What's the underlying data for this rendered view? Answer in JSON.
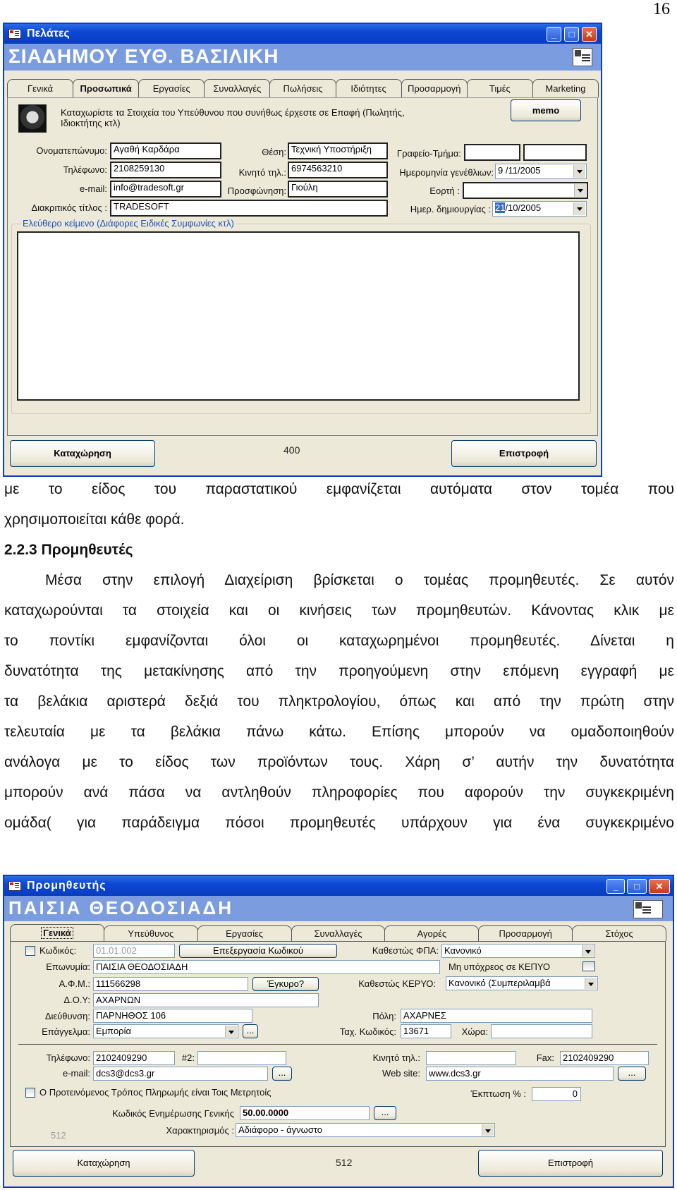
{
  "page_number": "16",
  "customer_window": {
    "title": "Πελάτες",
    "header_name": "ΣΙΑΔΗΜΟΥ ΕΥΘ. ΒΑΣΙΛΙΚΗ",
    "tabs": [
      {
        "label": "Γενικά",
        "active": false
      },
      {
        "label": "Προσωπικά",
        "active": true
      },
      {
        "label": "Εργασίες",
        "active": false
      },
      {
        "label": "Συναλλαγές",
        "active": false
      },
      {
        "label": "Πωλήσεις",
        "active": false
      },
      {
        "label": "Ιδιότητες",
        "active": false
      },
      {
        "label": "Προσαρμογή",
        "active": false
      },
      {
        "label": "Τιμές",
        "active": false
      },
      {
        "label": "Marketing",
        "active": false
      }
    ],
    "instruction": "Καταχωρίστε τα Στοιχεία του Υπεύθυνου που συνήθως έρχεστε σε Επαφή (Πωλητής, Ιδιοκτήτης κτλ)",
    "memo_label": "memo",
    "fields": {
      "fullname_label": "Ονοματεπώνυμο:",
      "fullname_value": "Αγαθή Καρδάρα",
      "phone_label": "Τηλέφωνο:",
      "phone_value": "2108259130",
      "email_label": "e-mail:",
      "email_value": "info@tradesoft.gr",
      "title_label": "Διακριτικός τίτλος :",
      "title_value": "TRADESOFT",
      "position_label": "Θέση:",
      "position_value": "Τεχνική Υποστήριξη",
      "mobile_label": "Κινητό τηλ.:",
      "mobile_value": "6974563210",
      "salutation_label": "Προσφώνηση:",
      "salutation_value": "Γιούλη",
      "office_label": "Γραφείο-Τμήμα:",
      "office_value_1": "",
      "office_value_2": "",
      "birthday_label": "Ημερομηνία γενέθλιων:",
      "birthday_value": "9 /11/2005",
      "nameday_label": "Εορτή :",
      "nameday_value": "",
      "created_label": "Ημερ. δημιουργίας :",
      "created_day": "21",
      "created_rest": "/10/2005"
    },
    "freetext_label": "Ελεύθερο κείμενο (Διάφορες Ειδικές Συμφωνίες κτλ)",
    "freetext_value": "",
    "save_label": "Καταχώρηση",
    "record_number": "400",
    "back_label": "Επιστροφή"
  },
  "document": {
    "para1": "με το είδος του παραστατικού εμφανίζεται αυτόματα στον τομέα που",
    "para1_end": "χρησιμοποιείται κάθε φορά.",
    "heading": "2.2.3 Προμηθευτές",
    "para2_lines": [
      "Μέσα στην επιλογή Διαχείριση βρίσκεται ο τομέας προμηθευτές. Σε αυτόν",
      "καταχωρούνται τα στοιχεία και οι κινήσεις των προμηθευτών. Κάνοντας κλικ με",
      "το ποντίκι εμφανίζονται όλοι οι καταχωρημένοι προμηθευτές. Δίνεται η",
      "δυνατότητα της μετακίνησης από την προηγούμενη στην επόμενη εγγραφή με",
      "τα βελάκια αριστερά δεξιά του πληκτρολογίου, όπως και από την πρώτη στην",
      "τελευταία με τα βελάκια πάνω κάτω. Επίσης μπορούν να ομαδοποιηθούν",
      "ανάλογα με το είδος των προϊόντων τους. Χάρη σ’ αυτήν την δυνατότητα",
      "μπορούν ανά πάσα να αντληθούν πληροφορίες που αφορούν την συγκεκριμένη",
      "ομάδα( για παράδειγμα πόσοι προμηθευτές υπάρχουν για ένα συγκεκριμένο"
    ]
  },
  "supplier_window": {
    "title": "Προμηθευτής",
    "header_name": "ΠΑΙΣΙΑ ΘΕΟΔΟΣΙΑΔΗ",
    "tabs": [
      {
        "label": "Γενικά",
        "active": true
      },
      {
        "label": "Υπεύθυνος",
        "active": false
      },
      {
        "label": "Εργασίες",
        "active": false
      },
      {
        "label": "Συναλλαγές",
        "active": false
      },
      {
        "label": "Αγορές",
        "active": false
      },
      {
        "label": "Προσαρμογή",
        "active": false
      },
      {
        "label": "Στόχος",
        "active": false
      }
    ],
    "code_label": "Κωδικός:",
    "code_value": "01.01.002",
    "edit_code_label": "Επεξεργασία Κωδικού",
    "vat_status_label": "Καθεστώς ΦΠΑ:",
    "vat_status_value": "Κανονικό",
    "name_label": "Επωνυμία:",
    "name_value": "ΠΑΙΣΙΑ ΘΕΟΔΟΣΙΑΔΗ",
    "kepyo_exempt_label": "Μη υπόχρεος σε ΚΕΠΥΟ",
    "afm_label": "Α.Φ.Μ.:",
    "afm_value": "111566298",
    "valid_label": "Έγκυρο?",
    "kepyo_status_label": "Καθεστώς ΚΕΡΥΟ:",
    "kepyo_status_value": "Κανονικό (Συμπεριλαμβά",
    "doy_label": "Δ.Ο.Υ:",
    "doy_value": "ΑΧΑΡΝΩΝ",
    "address_label": "Διεύθυνση:",
    "address_value": "ΠΑΡΝΗΘΟΣ 106",
    "city_label": "Πόλη:",
    "city_value": "ΑΧΑΡΝΕΣ",
    "profession_label": "Επάγγελμα:",
    "profession_value": "Εμπορία",
    "postal_label": "Ταχ. Κωδικός:",
    "postal_value": "13671",
    "country_label": "Χώρα:",
    "country_value": "",
    "phone_label": "Τηλέφωνο:",
    "phone_value": "2102409290",
    "phone2_label": "#2:",
    "phone2_value": "",
    "mobile_label": "Κινητό τηλ.:",
    "mobile_value": "",
    "fax_label": "Fax:",
    "fax_value": "2102409290",
    "email_label": "e-mail:",
    "email_value": "dcs3@dcs3.gr",
    "web_label": "Web site:",
    "web_value": "www.dcs3.gr",
    "ellipsis": "...",
    "cash_label": "Ο Προτεινόμενος Τρόπος Πληρωμής είναι Τοις Μετρητοίς",
    "discount_label": "Έκπτωση % :",
    "discount_value": "0",
    "ledger_label": "Κωδικός Ενημέρωσης Γενικής",
    "ledger_value": "50.00.0000",
    "char_label": "Χαρακτηρισμός :",
    "char_value": "Αδιάφορο - άγνωστο",
    "inner_number": "512",
    "save_label": "Καταχώρηση",
    "record_number": "512",
    "back_label": "Επιστροφή"
  }
}
